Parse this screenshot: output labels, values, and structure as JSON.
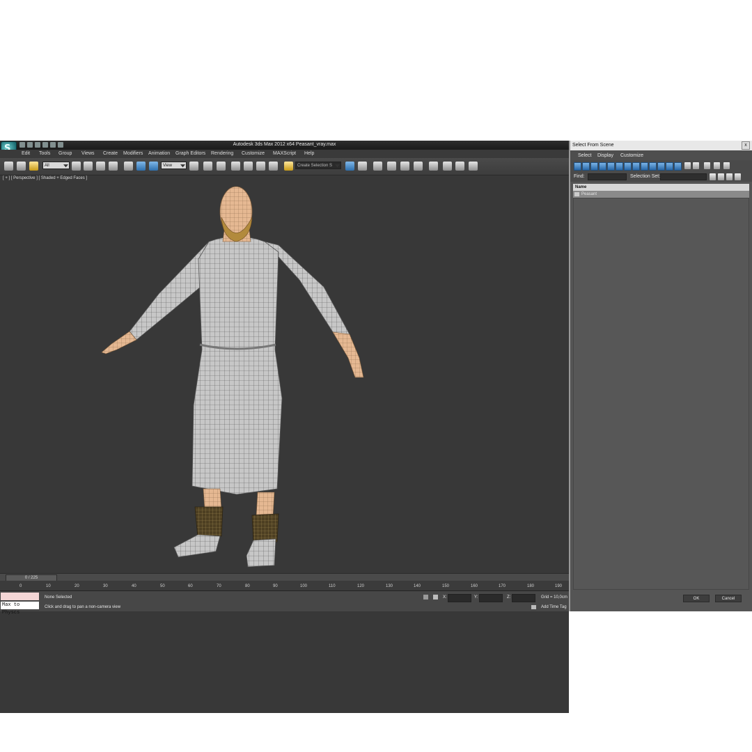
{
  "window": {
    "title": "Autodesk 3ds Max  2012 x64      Peasant_vray.max"
  },
  "menu": [
    "Edit",
    "Tools",
    "Group",
    "Views",
    "Create",
    "Modifiers",
    "Animation",
    "Graph Editors",
    "Rendering",
    "Customize",
    "MAXScript",
    "Help"
  ],
  "toolbar": {
    "filter_value": "All",
    "refcoord_value": "View",
    "selection_set_value": "Create Selection S"
  },
  "viewport": {
    "label": "[ + ] [ Perspective ] [ Shaded + Edged Faces ]"
  },
  "timeline": {
    "frame_readout": "0 / 225",
    "ticks": [
      "0",
      "10",
      "20",
      "30",
      "40",
      "50",
      "60",
      "70",
      "80",
      "90",
      "100",
      "110",
      "120",
      "130",
      "140",
      "150",
      "160",
      "170",
      "180",
      "190"
    ]
  },
  "status": {
    "selection": "None Selected",
    "prompt": "Click and drag to pan a non-camera view",
    "maxscript": "Max to Physcs",
    "x_label": "X:",
    "y_label": "Y:",
    "z_label": "Z:",
    "grid": "Grid = 10,0cm",
    "add_time_tag": "Add Time Tag"
  },
  "dialog": {
    "title": "Select From Scene",
    "close": "x",
    "menu": [
      "Select",
      "Display",
      "Customize"
    ],
    "find_label": "Find:",
    "selection_set_label": "Selection Set:",
    "column_name": "Name",
    "items": [
      "Peasant"
    ],
    "ok": "OK",
    "cancel": "Cancel"
  },
  "colors": {
    "viewport_bg": "#383838",
    "skin": "#e3b58e",
    "robe": "#c4c4c4",
    "wrap": "#6b5730",
    "accent_blue": "#3b7bbf"
  }
}
